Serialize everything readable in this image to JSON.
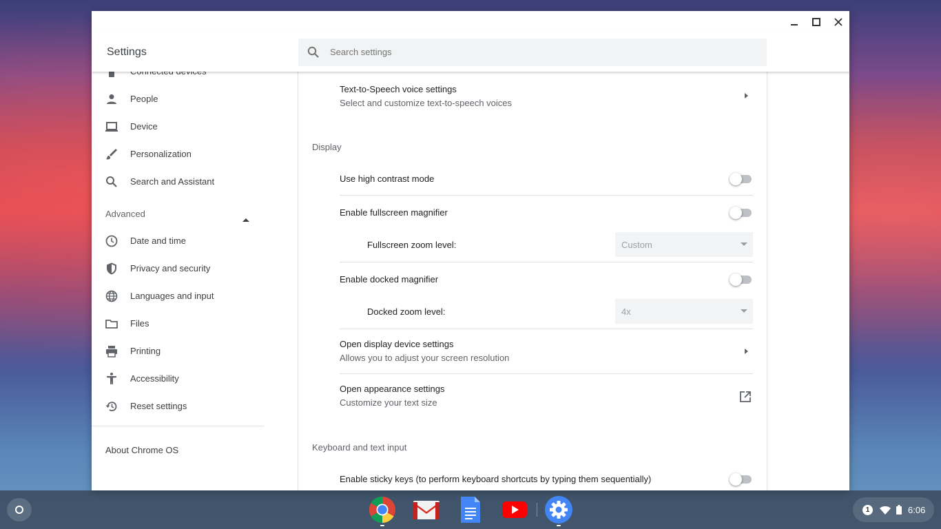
{
  "window": {
    "controls": {
      "minimize_icon": "minimize-icon",
      "maximize_icon": "maximize-icon",
      "close_icon": "close-icon"
    }
  },
  "header": {
    "title": "Settings",
    "search_placeholder": "Search settings"
  },
  "sidebar": {
    "items": [
      {
        "label": "Connected devices",
        "icon": "smartphone-icon"
      },
      {
        "label": "People",
        "icon": "person-icon"
      },
      {
        "label": "Device",
        "icon": "laptop-icon"
      },
      {
        "label": "Personalization",
        "icon": "brush-icon"
      },
      {
        "label": "Search and Assistant",
        "icon": "search-icon"
      }
    ],
    "advanced": {
      "label": "Advanced",
      "expanded": true
    },
    "advanced_items": [
      {
        "label": "Date and time",
        "icon": "clock-icon"
      },
      {
        "label": "Privacy and security",
        "icon": "shield-icon"
      },
      {
        "label": "Languages and input",
        "icon": "globe-icon"
      },
      {
        "label": "Files",
        "icon": "folder-icon"
      },
      {
        "label": "Printing",
        "icon": "printer-icon"
      },
      {
        "label": "Accessibility",
        "icon": "accessibility-icon"
      },
      {
        "label": "Reset settings",
        "icon": "history-icon"
      }
    ],
    "about": "About Chrome OS"
  },
  "main": {
    "tts": {
      "title": "Text-to-Speech voice settings",
      "subtitle": "Select and customize text-to-speech voices"
    },
    "display": {
      "heading": "Display",
      "high_contrast": {
        "label": "Use high contrast mode",
        "enabled": false
      },
      "fullscreen_magnifier": {
        "label": "Enable fullscreen magnifier",
        "enabled": false
      },
      "fullscreen_zoom": {
        "label": "Fullscreen zoom level:",
        "value": "Custom"
      },
      "docked_magnifier": {
        "label": "Enable docked magnifier",
        "enabled": false
      },
      "docked_zoom": {
        "label": "Docked zoom level:",
        "value": "4x"
      },
      "display_device": {
        "title": "Open display device settings",
        "subtitle": "Allows you to adjust your screen resolution"
      },
      "appearance": {
        "title": "Open appearance settings",
        "subtitle": "Customize your text size",
        "icon": "open-in-new-icon"
      }
    },
    "keyboard": {
      "heading": "Keyboard and text input",
      "sticky_keys": {
        "label": "Enable sticky keys (to perform keyboard shortcuts by typing them sequentially)",
        "enabled": false
      }
    }
  },
  "shelf": {
    "apps": [
      {
        "name": "Chrome",
        "icon": "chrome-icon",
        "running": true
      },
      {
        "name": "Gmail",
        "icon": "gmail-icon",
        "running": false
      },
      {
        "name": "Docs",
        "icon": "docs-icon",
        "running": false
      },
      {
        "name": "YouTube",
        "icon": "youtube-icon",
        "running": false
      },
      {
        "name": "Settings",
        "icon": "settings-gear-icon",
        "running": true
      }
    ],
    "tray": {
      "notification_count": "1",
      "time": "6:06",
      "wifi_icon": "wifi-icon",
      "battery_icon": "battery-icon"
    }
  },
  "colors": {
    "accent": "#1a73e8",
    "toggle_off_track": "#bdc1c6",
    "text_primary": "#202124",
    "text_secondary": "#5f6368"
  }
}
